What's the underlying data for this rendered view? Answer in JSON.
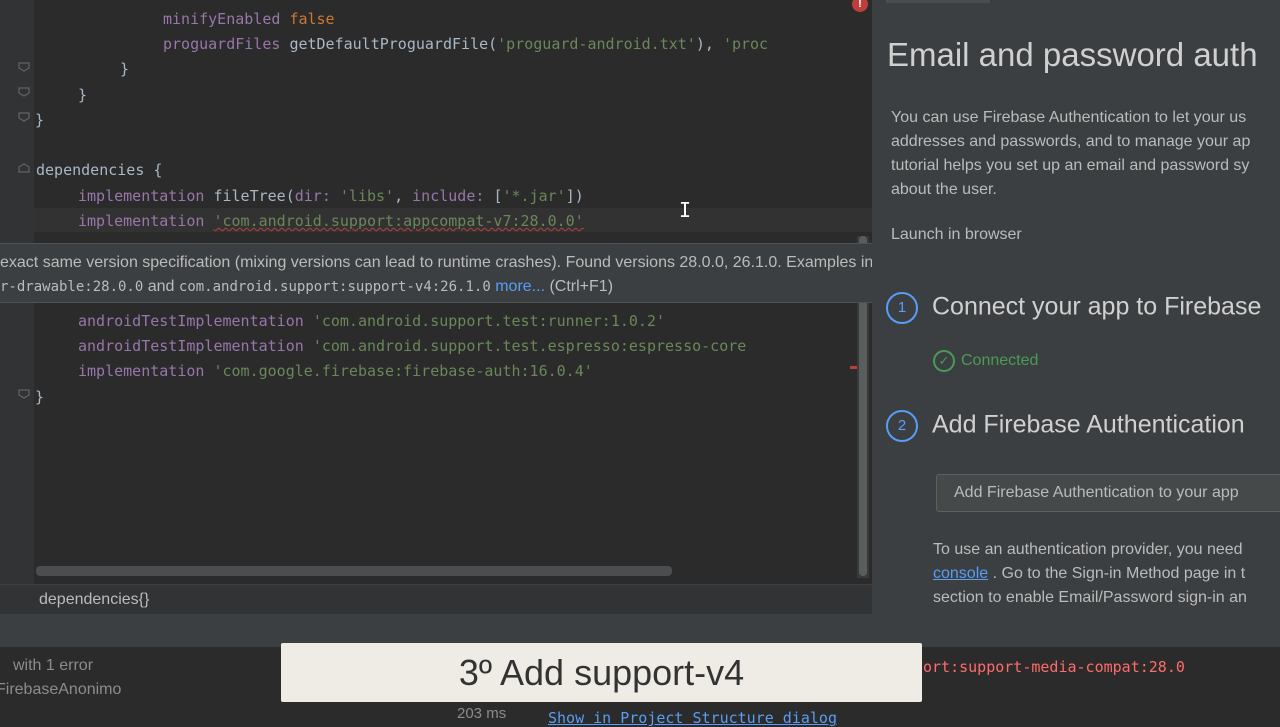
{
  "editor": {
    "lines": {
      "minify_key": "minifyEnabled",
      "minify_val": "false",
      "proguard_key": "proguardFiles",
      "proguard_fn": "getDefaultProguardFile(",
      "proguard_s1": "'proguard-android.txt'",
      "proguard_mid": "), ",
      "proguard_s2": "'proc",
      "brace_inner": "}",
      "brace_mid": "}",
      "brace_outer": "}",
      "dependencies": "dependencies {",
      "impl": "implementation",
      "filetree_fn": " fileTree(",
      "filetree_dir": "dir: ",
      "filetree_libs": "'libs'",
      "filetree_sep": ", ",
      "filetree_inc": "include: ",
      "filetree_arr_open": "[",
      "filetree_jar": "'*.jar'",
      "filetree_close": "])",
      "appcompat": "'com.android.support:appcompat-v7:28.0.0'",
      "android_test": "androidTestImplementation",
      "runner": "'com.android.support.test:runner:1.0.2'",
      "espresso": "'com.android.support.test.espresso:espresso-core",
      "firebase_auth": "'com.google.firebase:firebase-auth:16.0.4'",
      "closing": "}"
    }
  },
  "tooltip": {
    "line1": "exact same version specification (mixing versions can lead to runtime crashes). Found versions 28.0.0, 26.1.0. Examples include",
    "frag1": "r-drawable:28.0.0",
    "and": " and ",
    "frag2": "com.android.support:support-v4:26.1.0",
    "more": "more...",
    "shortcut": " (Ctrl+F1)"
  },
  "breadcrumb": "dependencies{}",
  "assistant": {
    "title": "Email and password auth",
    "desc": [
      "You can use Firebase Authentication to let your us",
      "addresses and passwords, and to manage your ap",
      "tutorial helps you set up an email and password sy",
      "about the user."
    ],
    "launch": "Launch in browser",
    "step1_num": "1",
    "step1": "Connect your app to Firebase",
    "connected": "Connected",
    "step2_num": "2",
    "step2": "Add Firebase Authentication",
    "add_button": "Add Firebase Authentication to your app",
    "provider_l1": "To use an authentication provider, you need",
    "provider_link": "console",
    "provider_l2": " . Go to the Sign-in Method page in t",
    "provider_l3": "section to enable Email/Password sign-in an"
  },
  "build": {
    "status": "with 1 error",
    "project": "FirebaseAnonimo",
    "time": "203 ms",
    "error_text": "ort:support-media-compat:28.0",
    "link": "Show in Project Structure dialog"
  },
  "caption": "3º Add support-v4",
  "colors": {
    "keyword": "#cc7832",
    "string": "#6a8759",
    "property": "#9876aa",
    "link": "#589df6",
    "error": "#bc3f3c",
    "success": "#499c54"
  }
}
